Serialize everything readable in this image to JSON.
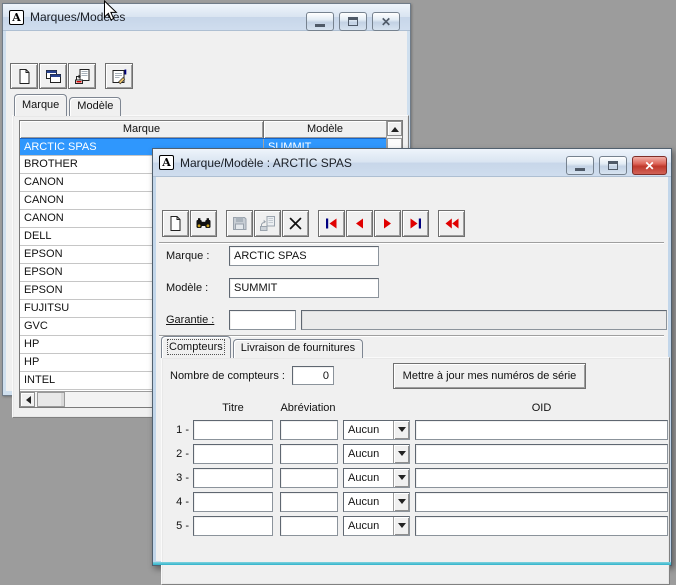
{
  "colors": {
    "selection_bg": "#2f97fd",
    "selection_text": "#ffffff",
    "titlebar": "#cfddee",
    "close_button_red": "#c0392c",
    "nav_arrow_red": "#e00000",
    "nav_bar_blue": "#000080",
    "frame_accent_teal": "#38b6ca"
  },
  "bg_window": {
    "title": "Marques/Modèles",
    "icon_letter": "A",
    "caption_buttons": [
      {
        "name": "minimize-button",
        "icon": "minimize-icon"
      },
      {
        "name": "maximize-button",
        "icon": "maximize-icon"
      },
      {
        "name": "close-button",
        "icon": "close-icon"
      }
    ],
    "toolbar": [
      {
        "name": "new-record-button",
        "icon": "new-document-icon"
      },
      {
        "name": "open-record-button",
        "icon": "cascade-windows-icon"
      },
      {
        "name": "transfer-button",
        "icon": "export-page-icon"
      },
      {
        "name": "properties-button",
        "icon": "properties-form-icon",
        "gap_before": true
      }
    ],
    "tabs": [
      {
        "label": "Marque",
        "active": true
      },
      {
        "label": "Modèle",
        "active": false
      }
    ],
    "table": {
      "columns": [
        "Marque",
        "Modèle"
      ],
      "rows": [
        {
          "marque": "ARCTIC SPAS",
          "modele": "SUMMIT",
          "selected": true
        },
        {
          "marque": "BROTHER",
          "modele": "",
          "selected": false
        },
        {
          "marque": "CANON",
          "modele": "",
          "selected": false
        },
        {
          "marque": "CANON",
          "modele": "",
          "selected": false
        },
        {
          "marque": "CANON",
          "modele": "",
          "selected": false
        },
        {
          "marque": "DELL",
          "modele": "",
          "selected": false
        },
        {
          "marque": "EPSON",
          "modele": "",
          "selected": false
        },
        {
          "marque": "EPSON",
          "modele": "",
          "selected": false
        },
        {
          "marque": "EPSON",
          "modele": "",
          "selected": false
        },
        {
          "marque": "FUJITSU",
          "modele": "",
          "selected": false
        },
        {
          "marque": "GVC",
          "modele": "",
          "selected": false
        },
        {
          "marque": "HP",
          "modele": "",
          "selected": false
        },
        {
          "marque": "HP",
          "modele": "",
          "selected": false
        },
        {
          "marque": "INTEL",
          "modele": "",
          "selected": false
        }
      ]
    }
  },
  "fg_window": {
    "title": "Marque/Modèle : ARCTIC SPAS",
    "icon_letter": "A",
    "caption_buttons": [
      {
        "name": "minimize-button",
        "icon": "minimize-icon"
      },
      {
        "name": "maximize-button",
        "icon": "maximize-icon"
      },
      {
        "name": "close-button",
        "icon": "close-icon",
        "active_close": true
      }
    ],
    "toolbar": [
      {
        "name": "new-record-button",
        "icon": "new-document-icon"
      },
      {
        "name": "find-button",
        "icon": "binoculars-icon"
      },
      {
        "name": "save-button",
        "icon": "save-icon",
        "disabled": true,
        "gap_before": true
      },
      {
        "name": "paste-button",
        "icon": "paste-icon",
        "disabled": true
      },
      {
        "name": "delete-button",
        "icon": "delete-x-icon"
      },
      {
        "name": "first-record-button",
        "icon": "nav-first-icon",
        "gap_before": true
      },
      {
        "name": "previous-record-button",
        "icon": "nav-previous-icon"
      },
      {
        "name": "next-record-button",
        "icon": "nav-next-icon"
      },
      {
        "name": "last-record-button",
        "icon": "nav-last-icon"
      },
      {
        "name": "rewind-button",
        "icon": "nav-rewind-icon",
        "gap_before": true
      }
    ],
    "fields": {
      "marque": {
        "label": "Marque :",
        "value": "ARCTIC SPAS"
      },
      "modele": {
        "label": "Modèle :",
        "value": "SUMMIT"
      },
      "garantie": {
        "label": "Garantie :",
        "value": "",
        "note": ""
      }
    },
    "tabs": [
      {
        "label": "Compteurs",
        "active": true,
        "focused": true
      },
      {
        "label": "Livraison de fournitures",
        "active": false
      }
    ],
    "compteurs": {
      "count_label": "Nombre de compteurs :",
      "count_value": "0",
      "update_button_label": "Mettre à jour mes numéros de série",
      "columns": [
        "Titre",
        "Abréviation",
        "OID"
      ],
      "rows": [
        {
          "index": "1 -",
          "titre": "",
          "abreviation": "",
          "unit": "Aucun",
          "oid": ""
        },
        {
          "index": "2 -",
          "titre": "",
          "abreviation": "",
          "unit": "Aucun",
          "oid": ""
        },
        {
          "index": "3 -",
          "titre": "",
          "abreviation": "",
          "unit": "Aucun",
          "oid": ""
        },
        {
          "index": "4 -",
          "titre": "",
          "abreviation": "",
          "unit": "Aucun",
          "oid": ""
        },
        {
          "index": "5 -",
          "titre": "",
          "abreviation": "",
          "unit": "Aucun",
          "oid": ""
        }
      ]
    }
  }
}
